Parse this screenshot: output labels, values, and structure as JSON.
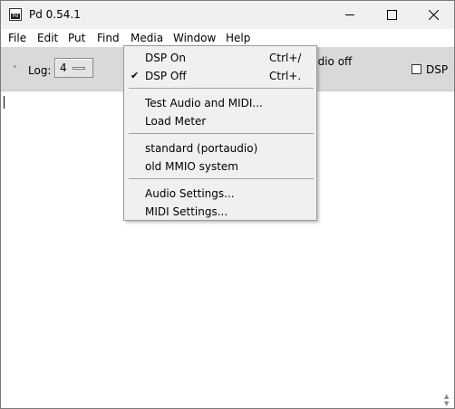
{
  "window": {
    "title": "Pd 0.54.1"
  },
  "menubar": {
    "items": [
      "File",
      "Edit",
      "Put",
      "Find",
      "Media",
      "Window",
      "Help"
    ]
  },
  "toolbar": {
    "log_label": "Log:",
    "log_value": "4",
    "audio_status": "udio off",
    "dsp_label": "DSP",
    "dsp_checked": false
  },
  "media_menu": {
    "dsp_on": {
      "label": "DSP On",
      "shortcut": "Ctrl+/"
    },
    "dsp_off": {
      "label": "DSP Off",
      "shortcut": "Ctrl+.",
      "checked": true
    },
    "test_audio": "Test Audio and MIDI...",
    "load_meter": "Load Meter",
    "api_standard": "standard (portaudio)",
    "api_mmio": "old MMIO system",
    "audio_settings": "Audio Settings...",
    "midi_settings": "MIDI Settings..."
  },
  "icons": {
    "check": "checkmark-icon",
    "app": "pd-app-icon"
  }
}
